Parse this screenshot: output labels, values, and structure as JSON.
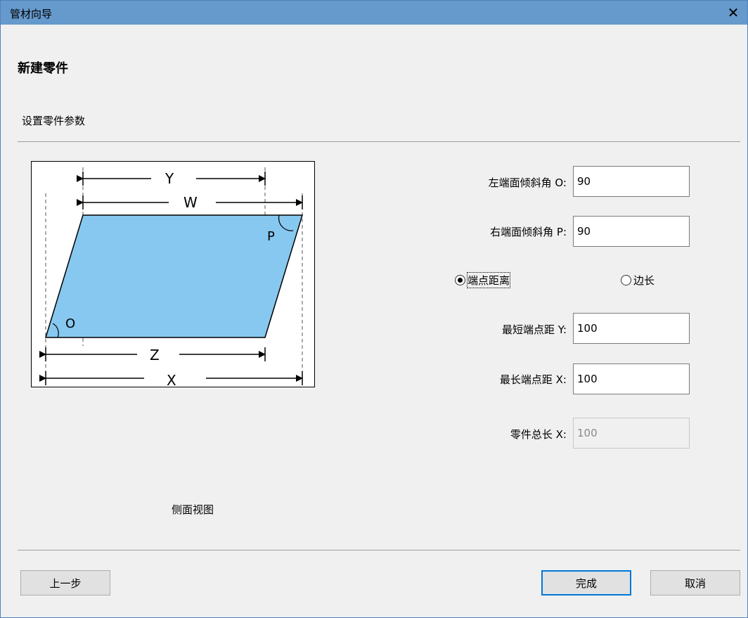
{
  "window": {
    "title": "管材向导",
    "close_glyph": "✕"
  },
  "page": {
    "heading": "新建零件",
    "subheading": "设置零件参数"
  },
  "diagram": {
    "labels": {
      "Y": "Y",
      "W": "W",
      "Z": "Z",
      "X": "X",
      "O": "O",
      "P": "P"
    },
    "fill_color": "#87c8f0",
    "caption": "侧面视图"
  },
  "form": {
    "left_angle": {
      "label": "左端面倾斜角 O:",
      "value": "90"
    },
    "right_angle": {
      "label": "右端面倾斜角 P:",
      "value": "90"
    },
    "mode_options": [
      {
        "label": "端点距离",
        "checked": true
      },
      {
        "label": "边长",
        "checked": false
      }
    ],
    "shortest": {
      "label": "最短端点距 Y:",
      "value": "100"
    },
    "longest": {
      "label": "最长端点距 X:",
      "value": "100"
    },
    "total_len": {
      "label": "零件总长 X:",
      "value": "100",
      "disabled": true
    }
  },
  "buttons": {
    "prev": "上一步",
    "finish": "完成",
    "cancel": "取消"
  },
  "colors": {
    "titlebar": "#6699cc",
    "accent": "#0078d7"
  }
}
